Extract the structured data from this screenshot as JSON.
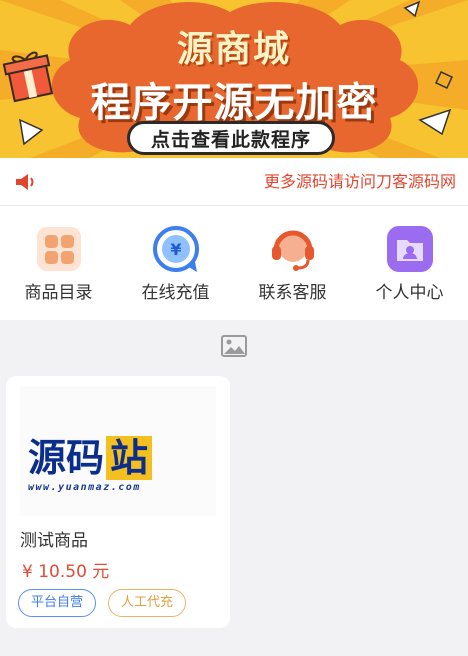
{
  "banner": {
    "title": "源商城",
    "subtitle": "程序开源无加密",
    "cta": "点击查看此款程序"
  },
  "notice": {
    "icon": "speaker-icon",
    "text": "更多源码请访问刀客源码网"
  },
  "menu": [
    {
      "label": "商品目录",
      "icon": "grid-icon"
    },
    {
      "label": "在线充值",
      "icon": "recharge-icon"
    },
    {
      "label": "联系客服",
      "icon": "headset-icon"
    },
    {
      "label": "个人中心",
      "icon": "user-folder-icon"
    }
  ],
  "placeholder_icon": "image-icon",
  "product": {
    "logo_text": [
      "源",
      "码",
      "站"
    ],
    "logo_url": "www.yuanmaz.com",
    "name": "测试商品",
    "price": "¥ 10.50 元",
    "tags": [
      "平台自营",
      "人工代充"
    ]
  },
  "colors": {
    "accent": "#e24a33",
    "banner_yellow": "#f7c331",
    "banner_orange": "#e8672e",
    "tag_blue": "#3f7de8",
    "tag_orange": "#e2a03f"
  }
}
